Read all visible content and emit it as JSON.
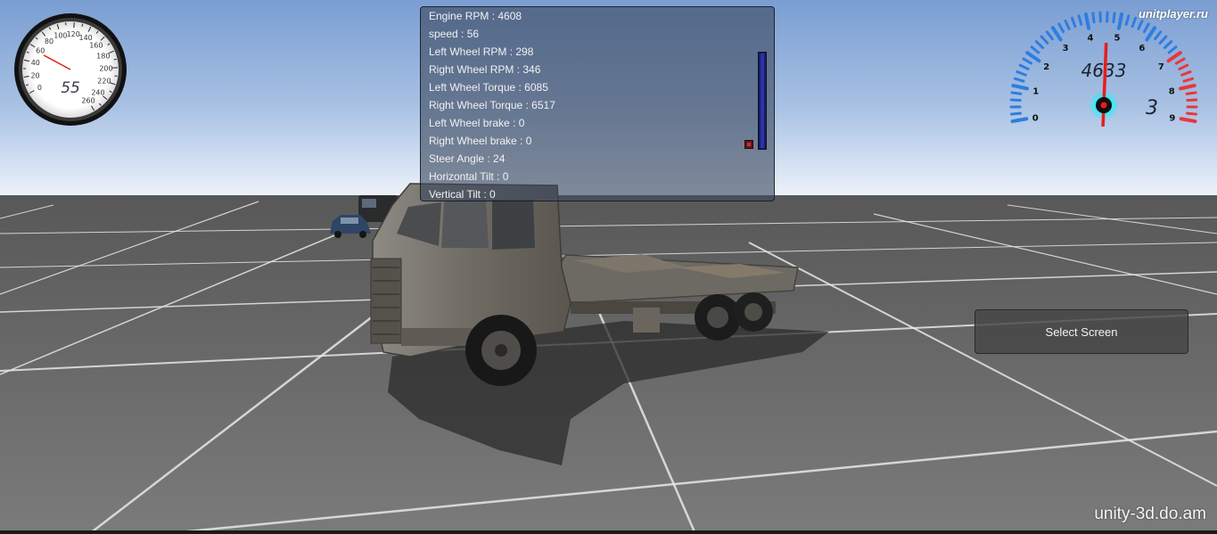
{
  "hud": {
    "info_lines": [
      "Engine RPM : 4608",
      "speed : 56",
      "Left Wheel RPM : 298",
      "Right Wheel RPM : 346",
      "Left Wheel Torque : 6085",
      "Right Wheel Torque : 6517",
      "Left Wheel brake : 0",
      "Right Wheel brake : 0",
      "Steer Angle : 24",
      "Horizontal Tilt : 0",
      "Vertical Tilt : 0"
    ],
    "throttle_level": 1.0
  },
  "speedometer": {
    "digital_readout": "55",
    "ticks": [
      "0",
      "20",
      "40",
      "60",
      "80",
      "100",
      "120",
      "140",
      "160",
      "180",
      "200",
      "220",
      "240",
      "260"
    ],
    "needle_value": 56
  },
  "tachometer": {
    "digital_rpm": "4633",
    "gear": "3",
    "ticks": [
      "0",
      "1",
      "2",
      "3",
      "4",
      "5",
      "6",
      "7",
      "8",
      "9"
    ],
    "needle_value": 4.6,
    "colors": {
      "scale": "#2f7de0",
      "redline": "#e8383c",
      "needle": "#e81c1c",
      "hub_glow": "#00e5e5"
    }
  },
  "select_screen_label": "Select Screen",
  "watermarks": {
    "top": "unitplayer.ru",
    "bottom": "unity-3d.do.am"
  },
  "scene": {
    "colors": {
      "sky_top": "#7a9ed2",
      "sky_bottom": "#e6eef8",
      "ground": "#6e6e6e",
      "grid": "#f0f0f0"
    }
  }
}
